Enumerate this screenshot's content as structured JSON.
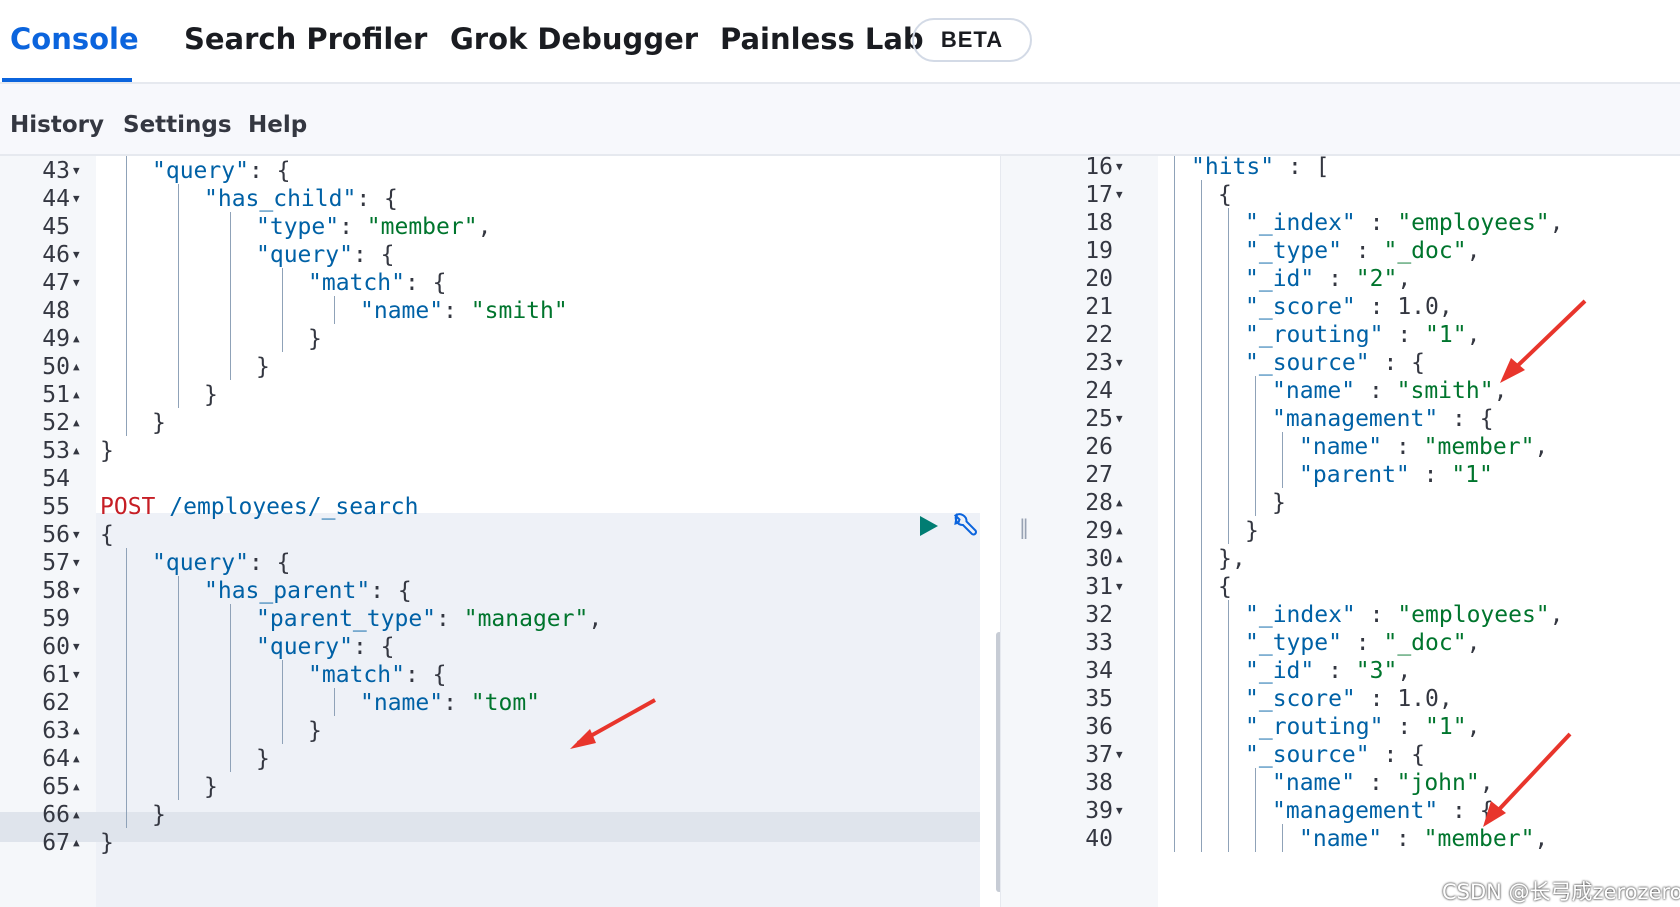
{
  "tabs": [
    {
      "label": "Console",
      "active": true
    },
    {
      "label": "Search Profiler",
      "active": false
    },
    {
      "label": "Grok Debugger",
      "active": false
    },
    {
      "label": "Painless Lab",
      "active": false
    }
  ],
  "beta_badge": "BETA",
  "toolbar": {
    "history": "History",
    "settings": "Settings",
    "help": "Help"
  },
  "request_editor": {
    "lines": [
      {
        "num": "43",
        "fold": "▼",
        "indent": 1,
        "tokens": [
          [
            "k",
            "\"query\""
          ],
          [
            "n",
            ": {"
          ]
        ]
      },
      {
        "num": "44",
        "fold": "▼",
        "indent": 2,
        "tokens": [
          [
            "k",
            "\"has_child\""
          ],
          [
            "n",
            ": {"
          ]
        ]
      },
      {
        "num": "45",
        "fold": "",
        "indent": 3,
        "tokens": [
          [
            "k",
            "\"type\""
          ],
          [
            "n",
            ": "
          ],
          [
            "s",
            "\"member\""
          ],
          [
            "n",
            ","
          ]
        ]
      },
      {
        "num": "46",
        "fold": "▼",
        "indent": 3,
        "tokens": [
          [
            "k",
            "\"query\""
          ],
          [
            "n",
            ": {"
          ]
        ]
      },
      {
        "num": "47",
        "fold": "▼",
        "indent": 4,
        "tokens": [
          [
            "k",
            "\"match\""
          ],
          [
            "n",
            ": {"
          ]
        ]
      },
      {
        "num": "48",
        "fold": "",
        "indent": 5,
        "tokens": [
          [
            "k",
            "\"name\""
          ],
          [
            "n",
            ": "
          ],
          [
            "s",
            "\"smith\""
          ]
        ]
      },
      {
        "num": "49",
        "fold": "▲",
        "indent": 4,
        "tokens": [
          [
            "n",
            "}"
          ]
        ]
      },
      {
        "num": "50",
        "fold": "▲",
        "indent": 3,
        "tokens": [
          [
            "n",
            "}"
          ]
        ]
      },
      {
        "num": "51",
        "fold": "▲",
        "indent": 2,
        "tokens": [
          [
            "n",
            "}"
          ]
        ]
      },
      {
        "num": "52",
        "fold": "▲",
        "indent": 1,
        "tokens": [
          [
            "n",
            "}"
          ]
        ]
      },
      {
        "num": "53",
        "fold": "▲",
        "indent": 0,
        "tokens": [
          [
            "n",
            "}"
          ]
        ]
      },
      {
        "num": "54",
        "fold": "",
        "indent": 0,
        "tokens": []
      },
      {
        "num": "55",
        "fold": "",
        "indent": 0,
        "tokens": [
          [
            "m",
            "POST"
          ],
          [
            "n",
            " "
          ],
          [
            "u",
            "/employees/_search"
          ]
        ]
      },
      {
        "num": "56",
        "fold": "▼",
        "indent": 0,
        "tokens": [
          [
            "n",
            "{"
          ]
        ]
      },
      {
        "num": "57",
        "fold": "▼",
        "indent": 1,
        "tokens": [
          [
            "k",
            "\"query\""
          ],
          [
            "n",
            ": {"
          ]
        ]
      },
      {
        "num": "58",
        "fold": "▼",
        "indent": 2,
        "tokens": [
          [
            "k",
            "\"has_parent\""
          ],
          [
            "n",
            ": {"
          ]
        ]
      },
      {
        "num": "59",
        "fold": "",
        "indent": 3,
        "tokens": [
          [
            "k",
            "\"parent_type\""
          ],
          [
            "n",
            ": "
          ],
          [
            "s",
            "\"manager\""
          ],
          [
            "n",
            ","
          ]
        ]
      },
      {
        "num": "60",
        "fold": "▼",
        "indent": 3,
        "tokens": [
          [
            "k",
            "\"query\""
          ],
          [
            "n",
            ": {"
          ]
        ]
      },
      {
        "num": "61",
        "fold": "▼",
        "indent": 4,
        "tokens": [
          [
            "k",
            "\"match\""
          ],
          [
            "n",
            ": {"
          ]
        ]
      },
      {
        "num": "62",
        "fold": "",
        "indent": 5,
        "tokens": [
          [
            "k",
            "\"name\""
          ],
          [
            "n",
            ": "
          ],
          [
            "s",
            "\"tom\""
          ]
        ]
      },
      {
        "num": "63",
        "fold": "▲",
        "indent": 4,
        "tokens": [
          [
            "n",
            "}"
          ]
        ]
      },
      {
        "num": "64",
        "fold": "▲",
        "indent": 3,
        "tokens": [
          [
            "n",
            "}"
          ]
        ]
      },
      {
        "num": "65",
        "fold": "▲",
        "indent": 2,
        "tokens": [
          [
            "n",
            "}"
          ]
        ]
      },
      {
        "num": "66",
        "fold": "▲",
        "indent": 1,
        "tokens": [
          [
            "n",
            "}"
          ]
        ]
      },
      {
        "num": "67",
        "fold": "▲",
        "indent": 0,
        "tokens": [
          [
            "n",
            "}"
          ]
        ]
      }
    ]
  },
  "response_viewer": {
    "lines": [
      {
        "num": "16",
        "fold": "▼",
        "indent": 1,
        "tokens": [
          [
            "k",
            "\"hits\""
          ],
          [
            "n",
            " : ["
          ]
        ]
      },
      {
        "num": "17",
        "fold": "▼",
        "indent": 2,
        "tokens": [
          [
            "n",
            "{"
          ]
        ]
      },
      {
        "num": "18",
        "fold": "",
        "indent": 3,
        "tokens": [
          [
            "k",
            "\"_index\""
          ],
          [
            "n",
            " : "
          ],
          [
            "s",
            "\"employees\""
          ],
          [
            "n",
            ","
          ]
        ]
      },
      {
        "num": "19",
        "fold": "",
        "indent": 3,
        "tokens": [
          [
            "k",
            "\"_type\""
          ],
          [
            "n",
            " : "
          ],
          [
            "s",
            "\"_doc\""
          ],
          [
            "n",
            ","
          ]
        ]
      },
      {
        "num": "20",
        "fold": "",
        "indent": 3,
        "tokens": [
          [
            "k",
            "\"_id\""
          ],
          [
            "n",
            " : "
          ],
          [
            "s",
            "\"2\""
          ],
          [
            "n",
            ","
          ]
        ]
      },
      {
        "num": "21",
        "fold": "",
        "indent": 3,
        "tokens": [
          [
            "k",
            "\"_score\""
          ],
          [
            "n",
            " : 1.0,"
          ]
        ]
      },
      {
        "num": "22",
        "fold": "",
        "indent": 3,
        "tokens": [
          [
            "k",
            "\"_routing\""
          ],
          [
            "n",
            " : "
          ],
          [
            "s",
            "\"1\""
          ],
          [
            "n",
            ","
          ]
        ]
      },
      {
        "num": "23",
        "fold": "▼",
        "indent": 3,
        "tokens": [
          [
            "k",
            "\"_source\""
          ],
          [
            "n",
            " : {"
          ]
        ]
      },
      {
        "num": "24",
        "fold": "",
        "indent": 4,
        "tokens": [
          [
            "k",
            "\"name\""
          ],
          [
            "n",
            " : "
          ],
          [
            "s",
            "\"smith\""
          ],
          [
            "n",
            ","
          ]
        ]
      },
      {
        "num": "25",
        "fold": "▼",
        "indent": 4,
        "tokens": [
          [
            "k",
            "\"management\""
          ],
          [
            "n",
            " : {"
          ]
        ]
      },
      {
        "num": "26",
        "fold": "",
        "indent": 5,
        "tokens": [
          [
            "k",
            "\"name\""
          ],
          [
            "n",
            " : "
          ],
          [
            "s",
            "\"member\""
          ],
          [
            "n",
            ","
          ]
        ]
      },
      {
        "num": "27",
        "fold": "",
        "indent": 5,
        "tokens": [
          [
            "k",
            "\"parent\""
          ],
          [
            "n",
            " : "
          ],
          [
            "s",
            "\"1\""
          ]
        ]
      },
      {
        "num": "28",
        "fold": "▲",
        "indent": 4,
        "tokens": [
          [
            "n",
            "}"
          ]
        ]
      },
      {
        "num": "29",
        "fold": "▲",
        "indent": 3,
        "tokens": [
          [
            "n",
            "}"
          ]
        ]
      },
      {
        "num": "30",
        "fold": "▲",
        "indent": 2,
        "tokens": [
          [
            "n",
            "},"
          ]
        ]
      },
      {
        "num": "31",
        "fold": "▼",
        "indent": 2,
        "tokens": [
          [
            "n",
            "{"
          ]
        ]
      },
      {
        "num": "32",
        "fold": "",
        "indent": 3,
        "tokens": [
          [
            "k",
            "\"_index\""
          ],
          [
            "n",
            " : "
          ],
          [
            "s",
            "\"employees\""
          ],
          [
            "n",
            ","
          ]
        ]
      },
      {
        "num": "33",
        "fold": "",
        "indent": 3,
        "tokens": [
          [
            "k",
            "\"_type\""
          ],
          [
            "n",
            " : "
          ],
          [
            "s",
            "\"_doc\""
          ],
          [
            "n",
            ","
          ]
        ]
      },
      {
        "num": "34",
        "fold": "",
        "indent": 3,
        "tokens": [
          [
            "k",
            "\"_id\""
          ],
          [
            "n",
            " : "
          ],
          [
            "s",
            "\"3\""
          ],
          [
            "n",
            ","
          ]
        ]
      },
      {
        "num": "35",
        "fold": "",
        "indent": 3,
        "tokens": [
          [
            "k",
            "\"_score\""
          ],
          [
            "n",
            " : 1.0,"
          ]
        ]
      },
      {
        "num": "36",
        "fold": "",
        "indent": 3,
        "tokens": [
          [
            "k",
            "\"_routing\""
          ],
          [
            "n",
            " : "
          ],
          [
            "s",
            "\"1\""
          ],
          [
            "n",
            ","
          ]
        ]
      },
      {
        "num": "37",
        "fold": "▼",
        "indent": 3,
        "tokens": [
          [
            "k",
            "\"_source\""
          ],
          [
            "n",
            " : {"
          ]
        ]
      },
      {
        "num": "38",
        "fold": "",
        "indent": 4,
        "tokens": [
          [
            "k",
            "\"name\""
          ],
          [
            "n",
            " : "
          ],
          [
            "s",
            "\"john\""
          ],
          [
            "n",
            ","
          ]
        ]
      },
      {
        "num": "39",
        "fold": "▼",
        "indent": 4,
        "tokens": [
          [
            "k",
            "\"management\""
          ],
          [
            "n",
            " : {"
          ]
        ]
      },
      {
        "num": "40",
        "fold": "",
        "indent": 5,
        "tokens": [
          [
            "k",
            "\"name\""
          ],
          [
            "n",
            " : "
          ],
          [
            "s",
            "\"member\""
          ],
          [
            "n",
            ","
          ]
        ]
      }
    ]
  },
  "watermark": "CSDN @长弓成zerozero",
  "colors": {
    "accent": "#0b64dd",
    "json_key": "#0061a6",
    "json_string": "#00752d",
    "http_method": "#c61e25",
    "annotation_arrow": "#e8352c"
  }
}
